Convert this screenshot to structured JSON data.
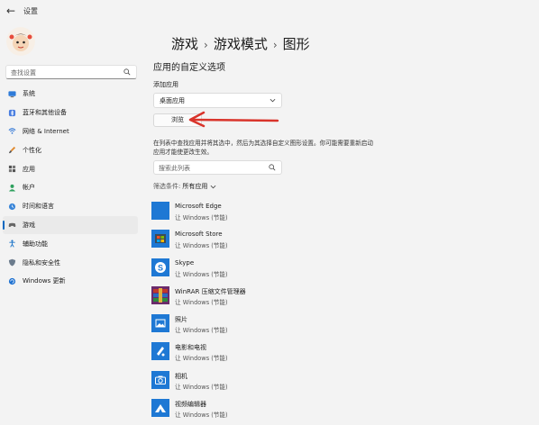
{
  "window": {
    "title": "设置"
  },
  "search": {
    "placeholder": "查找设置"
  },
  "sidebar": {
    "items": [
      {
        "label": "系统",
        "icon": "monitor-icon",
        "active": false
      },
      {
        "label": "蓝牙和其他设备",
        "icon": "bluetooth-icon",
        "active": false
      },
      {
        "label": "网络 & Internet",
        "icon": "wifi-icon",
        "active": false
      },
      {
        "label": "个性化",
        "icon": "brush-icon",
        "active": false
      },
      {
        "label": "应用",
        "icon": "apps-icon",
        "active": false
      },
      {
        "label": "帐户",
        "icon": "person-icon",
        "active": false
      },
      {
        "label": "时间和语言",
        "icon": "globe-clock-icon",
        "active": false
      },
      {
        "label": "游戏",
        "icon": "gamepad-icon",
        "active": true
      },
      {
        "label": "辅助功能",
        "icon": "accessibility-icon",
        "active": false
      },
      {
        "label": "隐私和安全性",
        "icon": "shield-icon",
        "active": false
      },
      {
        "label": "Windows 更新",
        "icon": "update-icon",
        "active": false
      }
    ]
  },
  "breadcrumb": {
    "part1": "游戏",
    "part2": "游戏模式",
    "part3": "图形",
    "sep": "›"
  },
  "main": {
    "section_title": "应用的自定义选项",
    "add_label": "添加应用",
    "dropdown_value": "桌面应用",
    "browse_label": "浏览",
    "description": "在列表中查找应用并将其选中，然后为其选择自定义图形设置。你可能需要重新启动应用才能使更改生效。",
    "list_search_placeholder": "搜索此列表",
    "filter_label": "筛选条件:",
    "filter_value": "所有应用"
  },
  "apps": [
    {
      "name": "Microsoft Edge",
      "sub": "让 Windows (节能)",
      "icon": "edge-icon"
    },
    {
      "name": "Microsoft Store",
      "sub": "让 Windows (节能)",
      "icon": "store-icon"
    },
    {
      "name": "Skype",
      "sub": "让 Windows (节能)",
      "icon": "skype-icon"
    },
    {
      "name": "WinRAR 压缩文件管理器",
      "sub": "让 Windows (节能)",
      "icon": "winrar-icon"
    },
    {
      "name": "照片",
      "sub": "让 Windows (节能)",
      "icon": "photos-icon"
    },
    {
      "name": "电影和电视",
      "sub": "让 Windows (节能)",
      "icon": "movies-tv-icon"
    },
    {
      "name": "相机",
      "sub": "让 Windows (节能)",
      "icon": "camera-icon"
    },
    {
      "name": "视频编辑器",
      "sub": "让 Windows (节能)",
      "icon": "video-editor-icon"
    }
  ],
  "colors": {
    "accent": "#0067c0",
    "annotation_arrow": "#d9342b",
    "tile_blue": "#1e78d4"
  }
}
